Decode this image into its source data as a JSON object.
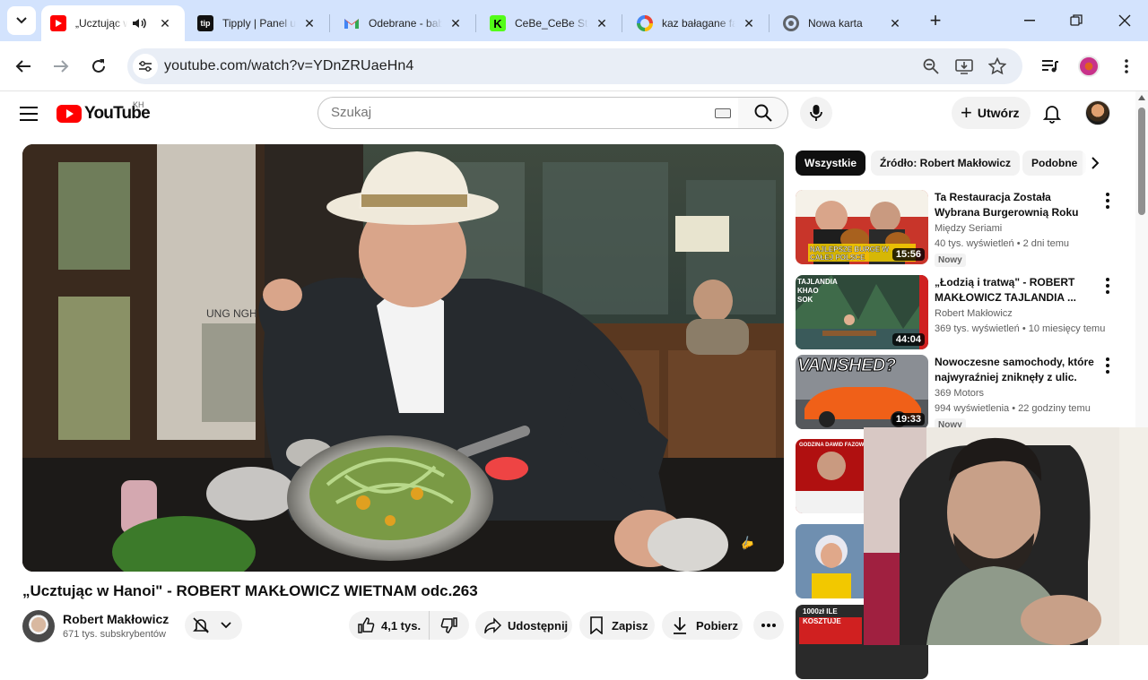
{
  "browser": {
    "tabs": [
      {
        "title": "„Ucztując w Hanoi\" - ROBERT MAKŁOWICZ WIETNAM odc.263 - YouTube",
        "active": true,
        "favicon": "youtube-icon",
        "color": "#ff0000"
      },
      {
        "title": "Tipply | Panel użytkownika",
        "favicon": "tipply-icon",
        "color": "#111111"
      },
      {
        "title": "Odebrane - babyface",
        "favicon": "gmail-icon",
        "color": "#ea4335"
      },
      {
        "title": "CeBe_CeBe Stream",
        "favicon": "kick-icon",
        "color": "#53fc18"
      },
      {
        "title": "kaz bałagane face",
        "favicon": "google-icon",
        "color": "#4285f4"
      },
      {
        "title": "Nowa karta",
        "favicon": "chrome-icon",
        "color": "#5f6368"
      }
    ],
    "url": "youtube.com/watch?v=YDnZRUaeHn4"
  },
  "yt": {
    "logo_text": "YouTube",
    "country_code": "KH",
    "search_placeholder": "Szukaj",
    "create_label": "Utwórz"
  },
  "video": {
    "title": "„Ucztując w Hanoi\" - ROBERT MAKŁOWICZ WIETNAM odc.263",
    "sign_text": "UNG NGH",
    "channel": "Robert Makłowicz",
    "subscribers": "671 tys. subskrybentów",
    "likes": "4,1 tys.",
    "share_label": "Udostępnij",
    "save_label": "Zapisz",
    "download_label": "Pobierz"
  },
  "sidebar": {
    "chips": [
      "Wszystkie",
      "Źródło: Robert Makłowicz",
      "Podobne"
    ],
    "recs": [
      {
        "title": "Ta Restauracja Została Wybrana Burgerownią Roku *Burgery z ...",
        "channel": "Między Seriami",
        "meta": "40 tys. wyświetleń • 2 dni temu",
        "badge": "Nowy",
        "duration": "15:56",
        "thumb_text": "NAJLEPSZE BURGE W CAŁEJ POLSCE"
      },
      {
        "title": "„Łodzią i tratwą\" - ROBERT MAKŁOWICZ TAJLANDIA ...",
        "channel": "Robert Makłowicz",
        "meta": "369 tys. wyświetleń • 10 miesięcy temu",
        "badge": "",
        "duration": "44:04",
        "thumb_text": "TAJLANDIA KHAO SOK"
      },
      {
        "title": "Nowoczesne samochody, które najwyraźniej zniknęły z ulic.",
        "channel": "369 Motors",
        "meta": "994 wyświetlenia • 22 godziny temu",
        "badge": "Nowy",
        "duration": "19:33",
        "thumb_text": "VANISHED?"
      },
      {
        "title": "",
        "channel": "",
        "meta": "",
        "badge": "",
        "duration": "",
        "thumb_text": "GODZINA DAWID FAZOWS"
      },
      {
        "title": "",
        "channel": "",
        "meta": "",
        "badge": "",
        "duration": "",
        "thumb_text": ""
      },
      {
        "title": "",
        "channel": "",
        "meta": "",
        "badge": "",
        "duration": "",
        "thumb_text": "1000zł ILE KOSZTUJE"
      }
    ]
  }
}
